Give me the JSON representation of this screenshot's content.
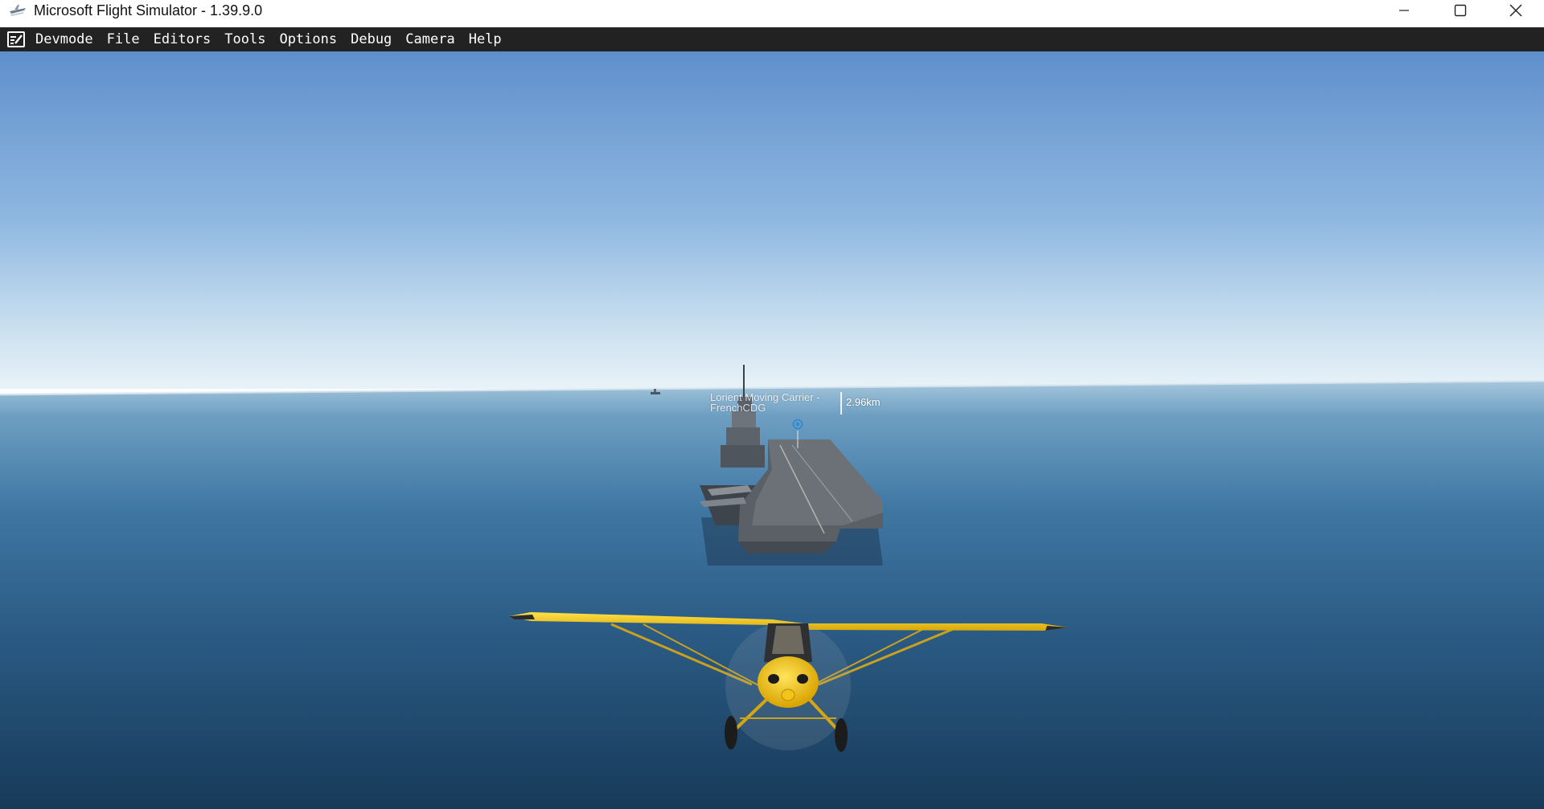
{
  "window": {
    "title": "Microsoft Flight Simulator - 1.39.9.0",
    "icon": "flight-simulator-app-icon",
    "controls": {
      "minimize": "minimize-icon",
      "maximize": "maximize-icon",
      "close": "close-icon"
    }
  },
  "menubar": {
    "icon": "devmode-icon",
    "items": [
      "Devmode",
      "File",
      "Editors",
      "Tools",
      "Options",
      "Debug",
      "Camera",
      "Help"
    ]
  },
  "scene": {
    "poi": {
      "name": "Lorient Moving Carrier - FrenchCDG",
      "distance": "2.96km",
      "marker": "target-marker-icon"
    }
  },
  "colors": {
    "titlebar_bg": "#ffffff",
    "menubar_bg": "#222222",
    "sky_top": "#5f8fcb",
    "sky_horizon": "#e6f1f8",
    "sea_near": "#1b3f5e",
    "plane_yellow": "#f3c51a"
  }
}
